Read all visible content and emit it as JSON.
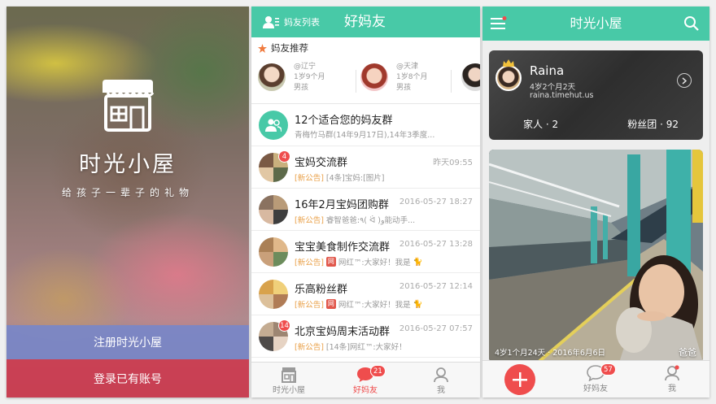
{
  "splash": {
    "app_name": "时光小屋",
    "tagline": "给孩子一辈子的礼物",
    "register_label": "注册时光小屋",
    "login_label": "登录已有账号"
  },
  "friends": {
    "header": {
      "friends_list_label": "妈友列表",
      "title": "好妈友"
    },
    "recommend": {
      "heading": "妈友推荐",
      "cards": [
        {
          "place": "@辽宁",
          "age": "1岁9个月",
          "gender": "男孩"
        },
        {
          "place": "@天津",
          "age": "1岁8个月",
          "gender": "男孩"
        }
      ]
    },
    "suggest": {
      "title": "12个适合您的妈友群",
      "subtitle": "青梅竹马群(14年9月17日),14年3季度..."
    },
    "groups": [
      {
        "name": "宝妈交流群",
        "time": "昨天09:55",
        "tag": "[新公告]",
        "message": "[4条]宝妈:[图片]",
        "badge": "4"
      },
      {
        "name": "16年2月宝妈团购群",
        "time": "2016-05-27 18:27",
        "tag": "[新公告]",
        "message": "睿智爸爸:٩( ᐛ )و能动手...",
        "badge": ""
      },
      {
        "name": "宝宝美食制作交流群",
        "time": "2016-05-27 13:28",
        "tag": "[新公告]",
        "message": "网红™:大家好！我是",
        "badge": ""
      },
      {
        "name": "乐高粉丝群",
        "time": "2016-05-27 12:14",
        "tag": "[新公告]",
        "message": "网红™:大家好！我是",
        "badge": ""
      },
      {
        "name": "北京宝妈周末活动群",
        "time": "2016-05-27 07:57",
        "tag": "[新公告]",
        "message": "[14条]网红™:大家好！",
        "badge": "14"
      }
    ],
    "tabbar": {
      "home_label": "时光小屋",
      "friends_label": "好妈友",
      "friends_badge": "21",
      "me_label": "我"
    }
  },
  "home": {
    "title": "时光小屋",
    "profile": {
      "name": "Raina",
      "age": "4岁2个月2天",
      "domain": "raina.timehut.us",
      "family": "家人 · 2",
      "fans": "粉丝团 · 92"
    },
    "photo": {
      "caption": "4岁1个月24天 · 2016年6月6日",
      "author": "爸爸"
    },
    "tabbar": {
      "friends_label": "好妈友",
      "friends_badge": "57",
      "me_label": "我"
    }
  },
  "colors": {
    "teal": "#48c9a7",
    "red": "#ef4d4d",
    "accent_orange": "#e9a14a"
  }
}
